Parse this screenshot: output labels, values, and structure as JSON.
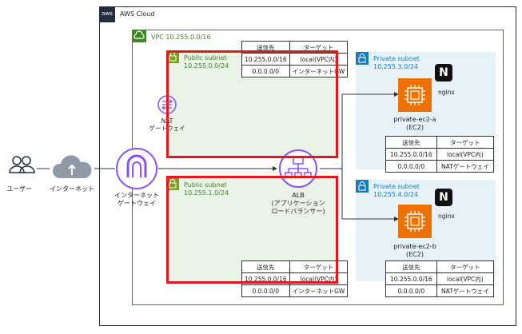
{
  "aws_cloud_label": "AWS Cloud",
  "aws_logo_text": "aws",
  "vpc_label": "VPC 10.255.0.0/16",
  "public_subnet_1": {
    "title": "Public subnet",
    "cidr": "10.255.0.0/24"
  },
  "public_subnet_2": {
    "title": "Public subnet",
    "cidr": "10.255.1.0/24"
  },
  "private_subnet_1": {
    "title": "Private subnet",
    "cidr": "10.255.3.0/24"
  },
  "private_subnet_2": {
    "title": "Private subnet",
    "cidr": "10.255.4.0/24"
  },
  "user_label": "ユーザー",
  "internet_label": "インターネット",
  "igw_label": [
    "インターネット",
    "ゲートウェイ"
  ],
  "nat_label": [
    "NAT",
    "ゲートウェイ"
  ],
  "alb_label": [
    "ALB",
    "(アプリケーション",
    "ロードバランサー)"
  ],
  "ec2_a_label": [
    "private-ec2-a",
    "(EC2)"
  ],
  "ec2_b_label": [
    "private-ec2-b",
    "(EC2)"
  ],
  "nginx_label": "nginx",
  "nginx_badge": "N",
  "route_tables": {
    "public_1": {
      "headers": [
        "送信先",
        "ターゲット"
      ],
      "rows": [
        [
          "10.255.0.0/16",
          "local(VPC内)"
        ],
        [
          "0.0.0.0/0",
          "インターネットGW"
        ]
      ]
    },
    "public_2": {
      "headers": [
        "送信先",
        "ターゲット"
      ],
      "rows": [
        [
          "10.255.0.0/16",
          "local(VPC内)"
        ],
        [
          "0.0.0.0/0",
          "インターネットGW"
        ]
      ]
    },
    "private_1": {
      "headers": [
        "送信先",
        "ターゲット"
      ],
      "rows": [
        [
          "10.255.0.0/16",
          "local(VPC内)"
        ],
        [
          "0.0.0.0/0",
          "NATゲートウェイ"
        ]
      ]
    },
    "private_2": {
      "headers": [
        "送信先",
        "ターゲット"
      ],
      "rows": [
        [
          "10.255.0.0/16",
          "local(VPC内)"
        ],
        [
          "0.0.0.0/0",
          "NATゲートウェイ"
        ]
      ]
    }
  },
  "colors": {
    "public_fill": "#e9f3e6",
    "public_border": "#7aa116",
    "private_fill": "#e6f2f8",
    "vpc_border": "#3f8624",
    "highlight": "#e0191f",
    "ec2": "#ed7100",
    "alb": "#8c4fff"
  }
}
